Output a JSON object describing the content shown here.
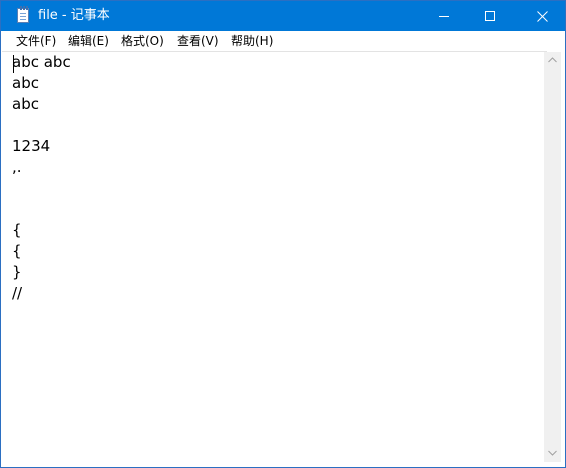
{
  "window": {
    "title": "file - 记事本",
    "accent_color": "#0078d7",
    "icon": "notepad-icon"
  },
  "caption_buttons": {
    "minimize_icon": "minimize-icon",
    "maximize_icon": "maximize-icon",
    "close_icon": "close-icon"
  },
  "menu": {
    "file": "文件(F)",
    "edit": "编辑(E)",
    "format": "格式(O)",
    "view": "查看(V)",
    "help": "帮助(H)"
  },
  "editor": {
    "lines": [
      "abc abc",
      "abc",
      "abc",
      "",
      "1234",
      ",.",
      "",
      "",
      "{",
      "{",
      "}",
      "//"
    ]
  },
  "scrollbar": {
    "up_icon": "chevron-up-icon",
    "down_icon": "chevron-down-icon"
  }
}
